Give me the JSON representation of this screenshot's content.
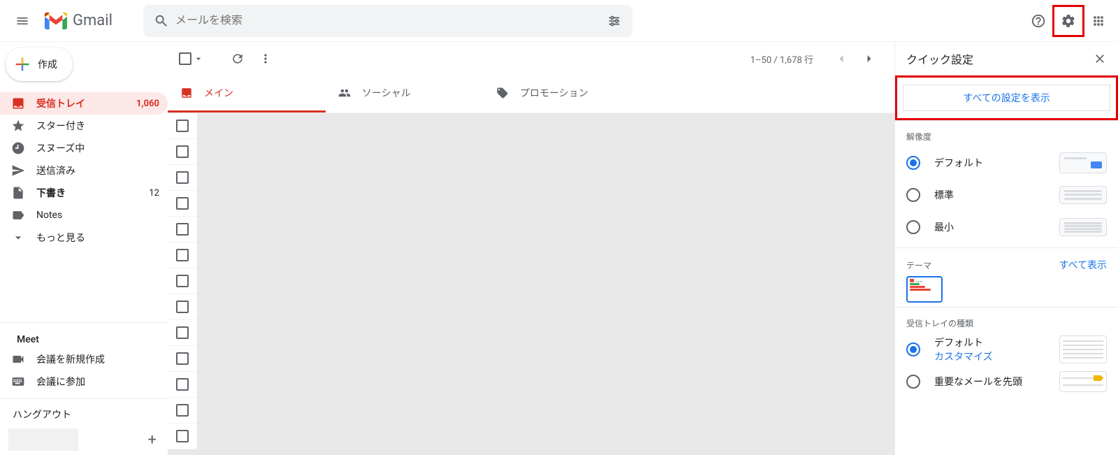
{
  "header": {
    "app_name": "Gmail",
    "search_placeholder": "メールを検索"
  },
  "compose_label": "作成",
  "nav": {
    "inbox": {
      "label": "受信トレイ",
      "count": "1,060"
    },
    "starred": {
      "label": "スター付き"
    },
    "snoozed": {
      "label": "スヌーズ中"
    },
    "sent": {
      "label": "送信済み"
    },
    "drafts": {
      "label": "下書き",
      "count": "12"
    },
    "notes": {
      "label": "Notes"
    },
    "more": {
      "label": "もっと見る"
    }
  },
  "meet": {
    "section": "Meet",
    "new": "会議を新規作成",
    "join": "会議に参加"
  },
  "hangouts": {
    "section": "ハングアウト"
  },
  "toolbar": {
    "pager": "1–50 / 1,678 行"
  },
  "tabs": {
    "main": "メイン",
    "social": "ソーシャル",
    "promo": "プロモーション"
  },
  "settings": {
    "title": "クイック設定",
    "all": "すべての設定を表示",
    "density": {
      "title": "解像度",
      "default": "デフォルト",
      "comfortable": "標準",
      "compact": "最小"
    },
    "theme": {
      "title": "テーマ",
      "all": "すべて表示"
    },
    "inbox": {
      "title": "受信トレイの種類",
      "default": "デフォルト",
      "customize": "カスタマイズ",
      "important": "重要なメールを先頭"
    }
  }
}
